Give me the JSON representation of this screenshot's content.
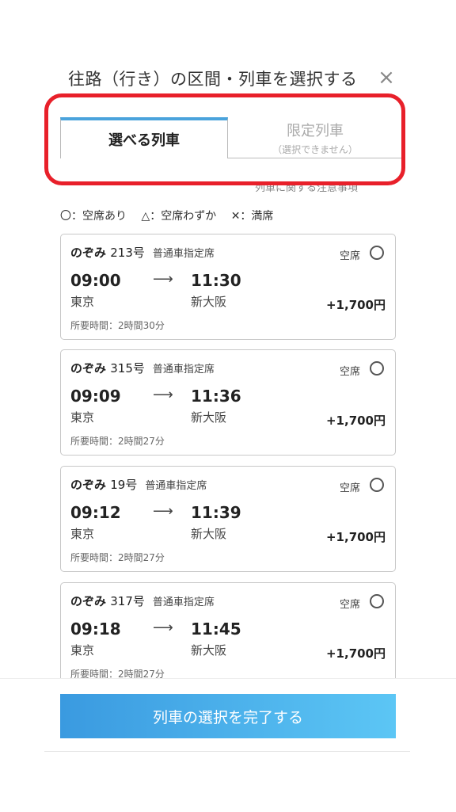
{
  "header": {
    "title": "往路（行き）の区間・列車を選択する",
    "close_icon": "×"
  },
  "tabs": [
    {
      "label": "選べる列車",
      "active": true
    },
    {
      "label": "限定列車",
      "sublabel": "（選択できません）",
      "active": false
    }
  ],
  "notice_link": "列車に関する注意事項",
  "legend": {
    "available": "〇：空席あり",
    "few": "△：空席わずか",
    "full": "✕：満席"
  },
  "trains": [
    {
      "name": "のぞみ",
      "number": "213号",
      "seat_type": "普通車指定席",
      "status": "空席",
      "dep_time": "09:00",
      "arr_time": "11:30",
      "from": "東京",
      "to": "新大阪",
      "price": "+1,700円",
      "duration": "所要時間：2時間30分"
    },
    {
      "name": "のぞみ",
      "number": "315号",
      "seat_type": "普通車指定席",
      "status": "空席",
      "dep_time": "09:09",
      "arr_time": "11:36",
      "from": "東京",
      "to": "新大阪",
      "price": "+1,700円",
      "duration": "所要時間：2時間27分"
    },
    {
      "name": "のぞみ",
      "number": "19号",
      "seat_type": "普通車指定席",
      "status": "空席",
      "dep_time": "09:12",
      "arr_time": "11:39",
      "from": "東京",
      "to": "新大阪",
      "price": "+1,700円",
      "duration": "所要時間：2時間27分"
    },
    {
      "name": "のぞみ",
      "number": "317号",
      "seat_type": "普通車指定席",
      "status": "空席",
      "dep_time": "09:18",
      "arr_time": "11:45",
      "from": "東京",
      "to": "新大阪",
      "price": "+1,700円",
      "duration": "所要時間：2時間27分"
    }
  ],
  "arrow": "⟶",
  "submit_label": "列車の選択を完了する",
  "colors": {
    "highlight": "#e8202a",
    "accent": "#4aa3dc"
  }
}
